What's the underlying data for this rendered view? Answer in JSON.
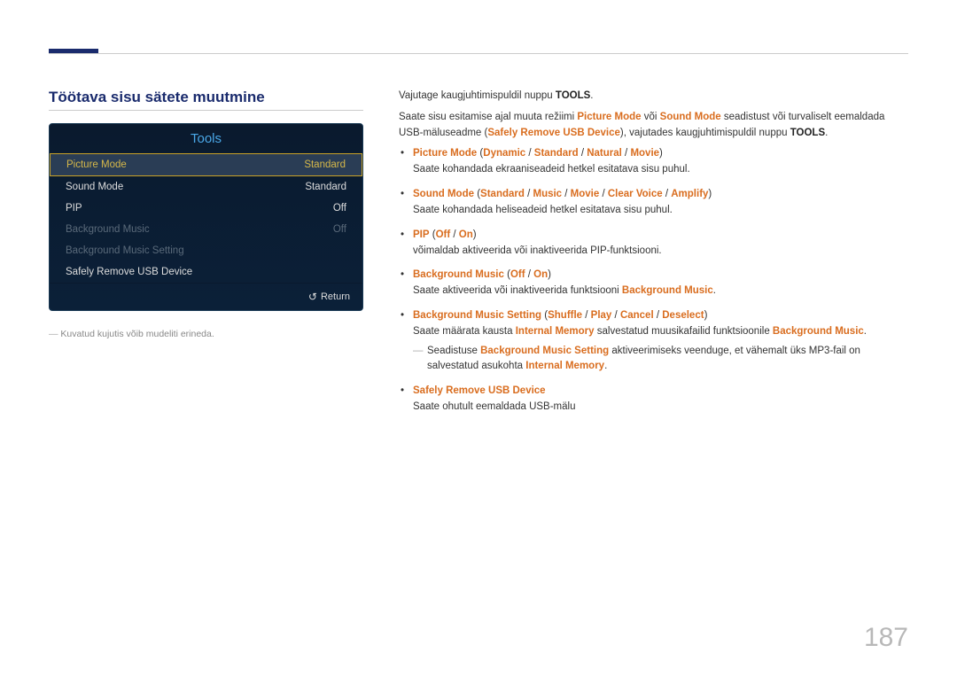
{
  "page_number": "187",
  "section_title": "Töötava sisu sätete muutmine",
  "tools_panel": {
    "title": "Tools",
    "rows": [
      {
        "label": "Picture Mode",
        "value": "Standard",
        "state": "selected"
      },
      {
        "label": "Sound Mode",
        "value": "Standard",
        "state": "normal"
      },
      {
        "label": "PIP",
        "value": "Off",
        "state": "normal"
      },
      {
        "label": "Background Music",
        "value": "Off",
        "state": "disabled"
      },
      {
        "label": "Background Music Setting",
        "value": "",
        "state": "disabled"
      },
      {
        "label": "Safely Remove USB Device",
        "value": "",
        "state": "normal"
      }
    ],
    "return_label": "Return"
  },
  "caption": "Kuvatud kujutis võib mudeliti erineda.",
  "intro": {
    "line1_a": "Vajutage kaugjuhtimispuldil nuppu ",
    "line1_b": "TOOLS",
    "line1_c": ".",
    "line2_a": "Saate sisu esitamise ajal muuta režiimi ",
    "pm": "Picture Mode",
    "line2_b": " või ",
    "sm": "Sound Mode",
    "line2_c": " seadistust või turvaliselt eemaldada USB-mäluseadme (",
    "sr": "Safely Remove USB Device",
    "line2_d": "), vajutades kaugjuhtimispuldil nuppu ",
    "tools2": "TOOLS",
    "line2_e": "."
  },
  "items": {
    "picture_mode": {
      "name": "Picture Mode",
      "opts": {
        "a": "Dynamic",
        "b": "Standard",
        "c": "Natural",
        "d": "Movie"
      },
      "desc": "Saate kohandada ekraaniseadeid hetkel esitatava sisu puhul."
    },
    "sound_mode": {
      "name": "Sound Mode",
      "opts": {
        "a": "Standard",
        "b": "Music",
        "c": "Movie",
        "d": "Clear Voice",
        "e": "Amplify"
      },
      "desc": "Saate kohandada heliseadeid hetkel esitatava sisu puhul."
    },
    "pip": {
      "name": "PIP",
      "opts": {
        "a": "Off",
        "b": "On"
      },
      "desc": "võimaldab aktiveerida või inaktiveerida PIP-funktsiooni."
    },
    "bg_music": {
      "name": "Background Music",
      "opts": {
        "a": "Off",
        "b": "On"
      },
      "desc_a": "Saate aktiveerida või inaktiveerida funktsiooni ",
      "desc_b": "Background Music",
      "desc_c": "."
    },
    "bg_music_setting": {
      "name": "Background Music Setting",
      "opts": {
        "a": "Shuffle",
        "b": "Play",
        "c": "Cancel",
        "d": "Deselect"
      },
      "desc_a": "Saate määrata kausta ",
      "im": "Internal Memory",
      "desc_b": " salvestatud muusikafailid funktsioonile ",
      "bm": "Background Music",
      "desc_c": ".",
      "note_a": "Seadistuse ",
      "note_name": "Background Music Setting",
      "note_b": " aktiveerimiseks veenduge, et vähemalt üks MP3-fail on salvestatud asukohta ",
      "note_im": "Internal Memory",
      "note_c": "."
    },
    "safely_remove": {
      "name": "Safely Remove USB Device",
      "desc": "Saate ohutult eemaldada USB-mälu"
    }
  }
}
